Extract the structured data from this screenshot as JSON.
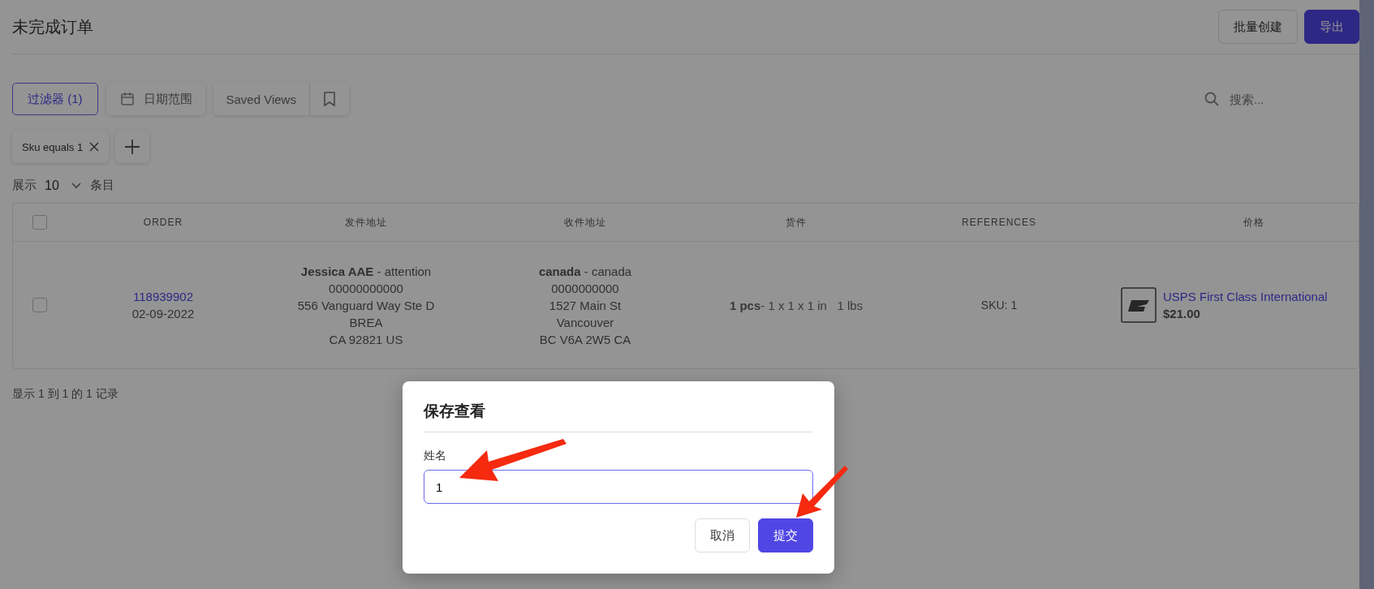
{
  "page": {
    "title": "未完成订单",
    "header_buttons": [
      {
        "label": "批量创建",
        "kind": "secondary"
      },
      {
        "label": "导出",
        "kind": "primary"
      }
    ],
    "toolbar": {
      "filter_button": "过滤器 (1)",
      "date_range": "日期范围",
      "saved_views": "Saved Views",
      "search": {
        "placeholder": "搜索..."
      }
    },
    "active_filters": [
      {
        "label": "Sku equals 1"
      }
    ],
    "page_size": {
      "prefix": "展示",
      "value": "10",
      "suffix": "条目"
    },
    "table": {
      "select_all": {
        "checked": false
      },
      "columns": [
        "ORDER",
        "发件地址",
        "收件地址",
        "货件",
        "REFERENCES",
        "价格"
      ],
      "rows": [
        {
          "checked": false,
          "order": {
            "number": "118939902",
            "date": "02-09-2022"
          },
          "sender": [
            "**Jessica AAE** - attention",
            "00000000000",
            "556 Vanguard Way Ste D",
            "BREA",
            "CA 92821 US"
          ],
          "recipient": [
            "**canada** - canada",
            "0000000000",
            "1527 Main St",
            "Vancouver",
            "BC V6A 2W5 CA"
          ],
          "parcel": "**1 pcs**- 1 x 1 x 1 in   1 lbs",
          "references": "SKU: 1",
          "price": {
            "service": "USPS First Class International",
            "amount": "$21.00"
          }
        }
      ]
    },
    "footer": "显示 1 到 1 的 1 记录"
  },
  "dialog": {
    "title": "保存查看",
    "field_label": "姓名",
    "value": "1",
    "buttons": [
      {
        "label": "取消",
        "kind": "secondary"
      },
      {
        "label": "提交",
        "kind": "primary"
      }
    ]
  }
}
